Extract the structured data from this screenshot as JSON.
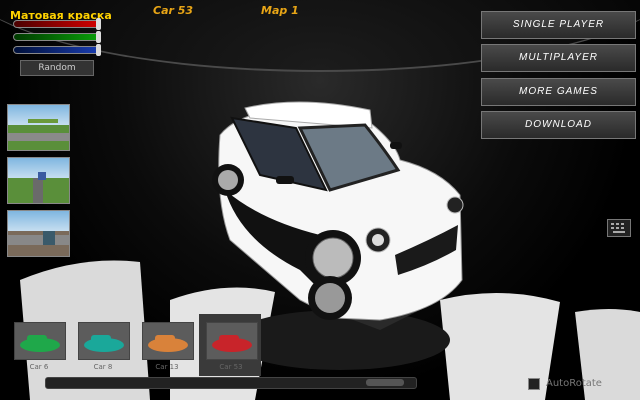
{
  "hud": {
    "paint_title": "Матовая краска",
    "car_label": "Car 53",
    "map_label": "Map 1",
    "random_label": "Random"
  },
  "color_sliders": [
    {
      "name": "red",
      "value": 1.0,
      "color": "#d40000"
    },
    {
      "name": "green",
      "value": 1.0,
      "color": "#0aa00a"
    },
    {
      "name": "blue",
      "value": 1.0,
      "color": "#1a3db0"
    }
  ],
  "menu": [
    {
      "label": "SINGLE PLAYER"
    },
    {
      "label": "MULTIPLAYER"
    },
    {
      "label": "MORE GAMES"
    },
    {
      "label": "DOWNLOAD"
    }
  ],
  "map_thumbnails": [
    "map-1",
    "map-2",
    "map-3"
  ],
  "car_list": [
    {
      "name": "Car 6",
      "color": "#1fa84a"
    },
    {
      "name": "Car 8",
      "color": "#1aa89a"
    },
    {
      "name": "Car 13",
      "color": "#d9823a"
    },
    {
      "name": "Car 53",
      "color": "#c8242a",
      "selected": true
    }
  ],
  "auto_rotate": {
    "label": "AutoRotate",
    "checked": false
  },
  "colors": {
    "accent": "#e8a516",
    "title": "#ffd200"
  }
}
